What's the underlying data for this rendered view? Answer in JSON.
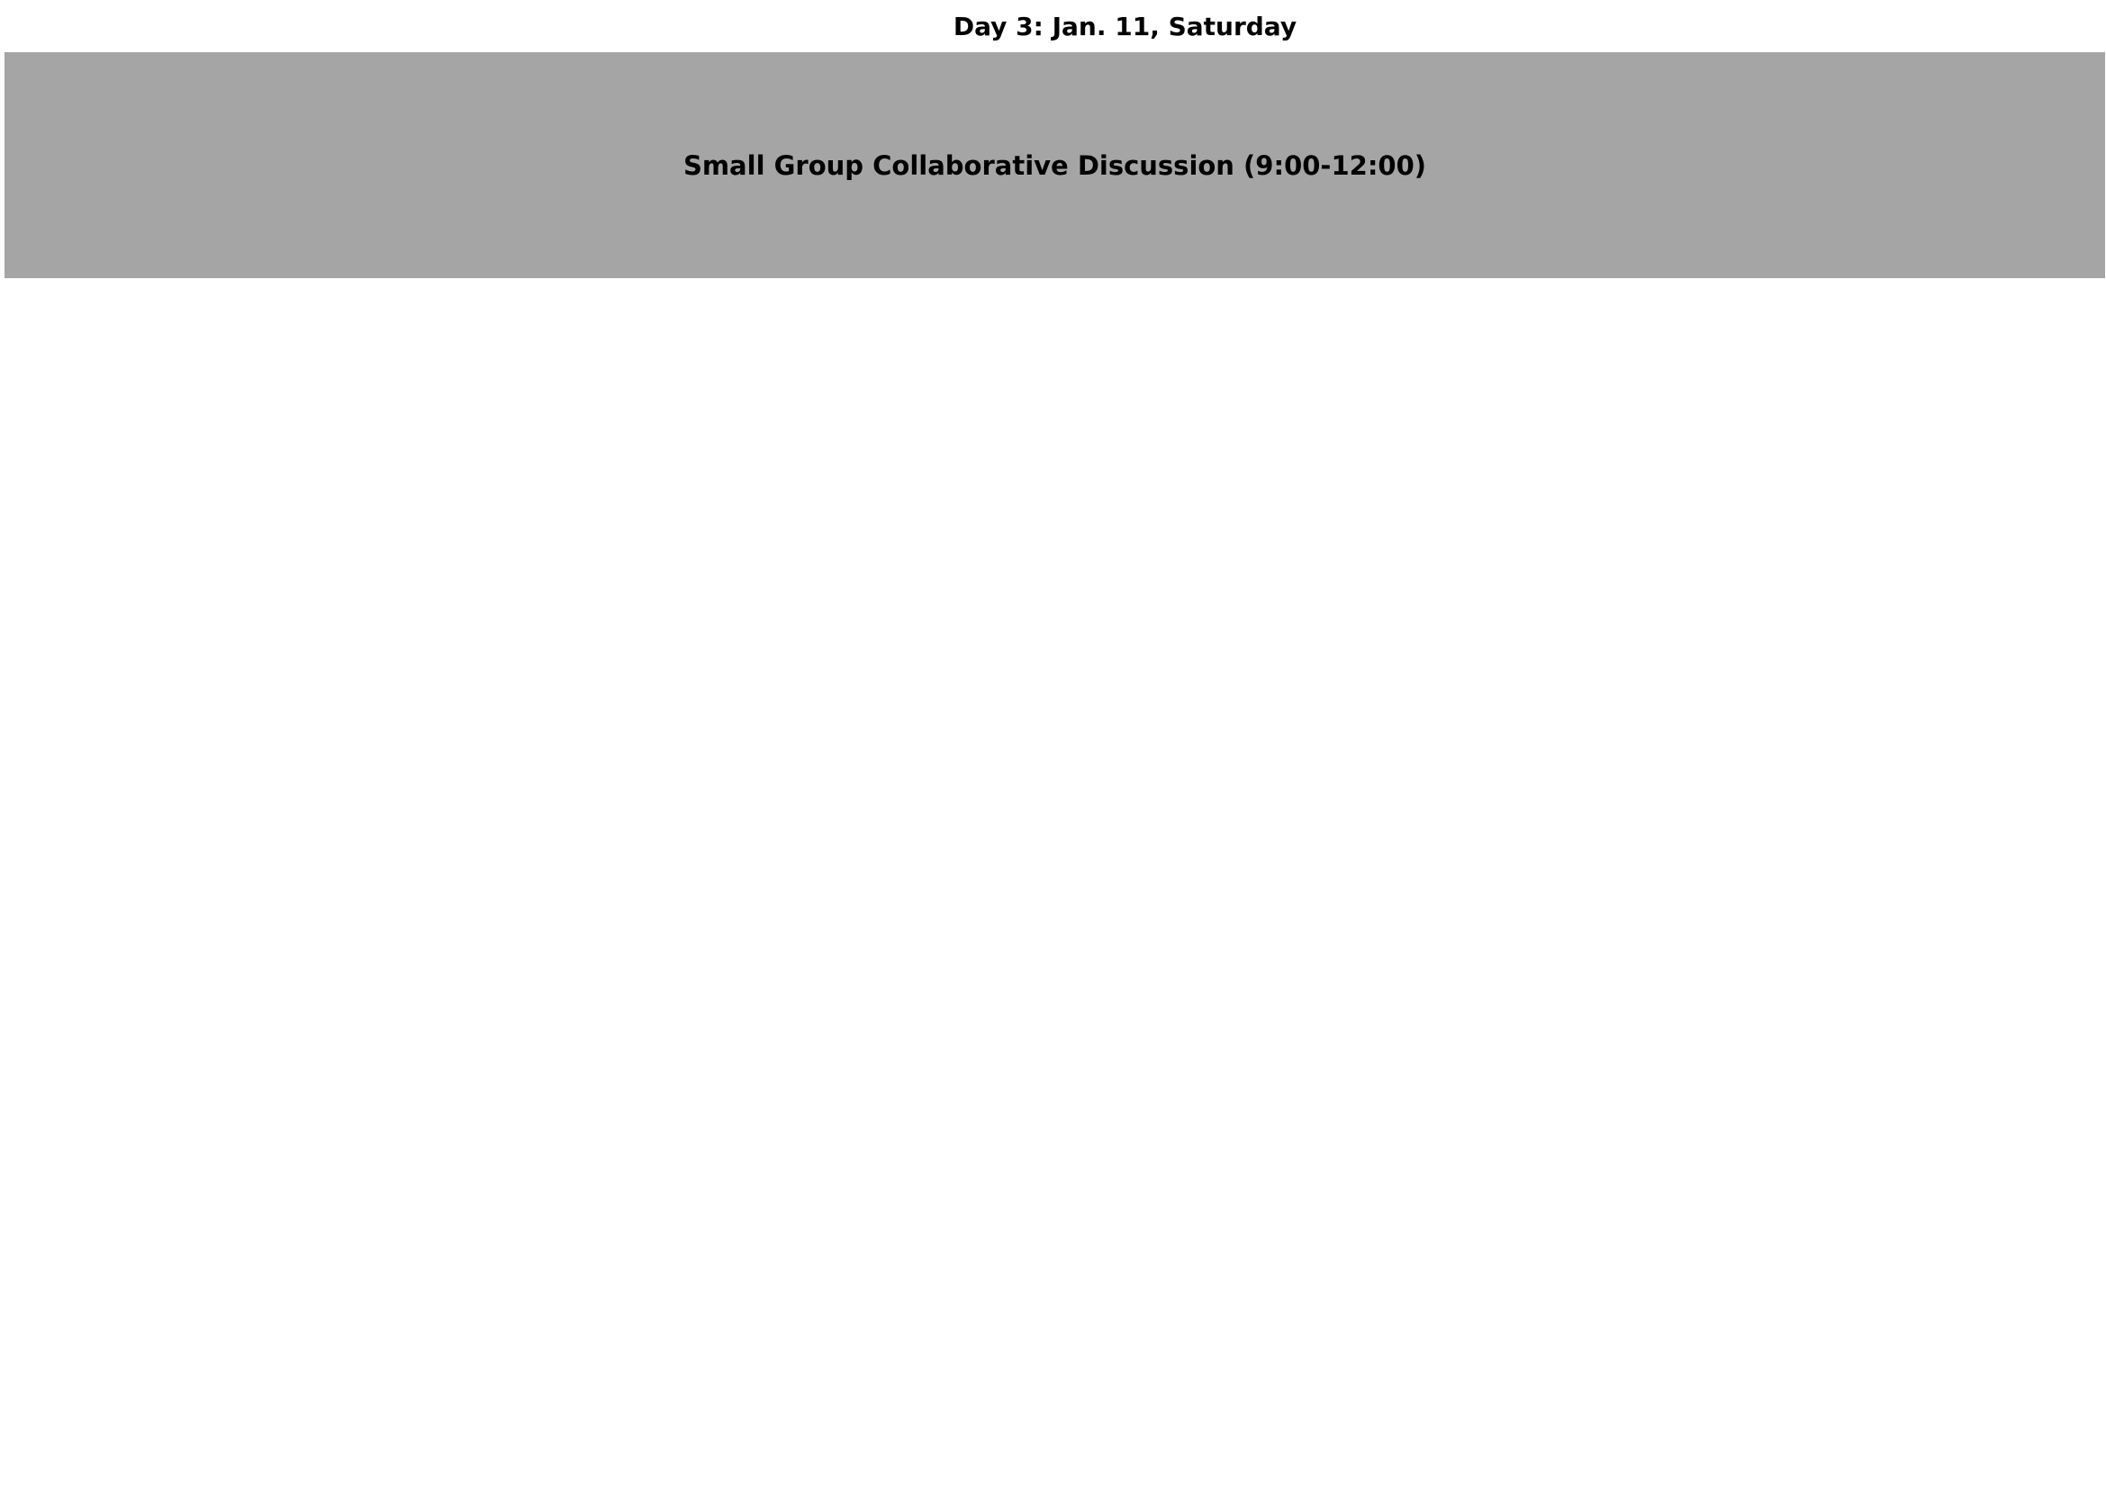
{
  "schedule": {
    "day_title": "Day 3: Jan. 11, Saturday",
    "sessions": [
      {
        "label": "Small Group Collaborative Discussion (9:00-12:00)",
        "fill_color": "#a5a5a5"
      }
    ]
  }
}
